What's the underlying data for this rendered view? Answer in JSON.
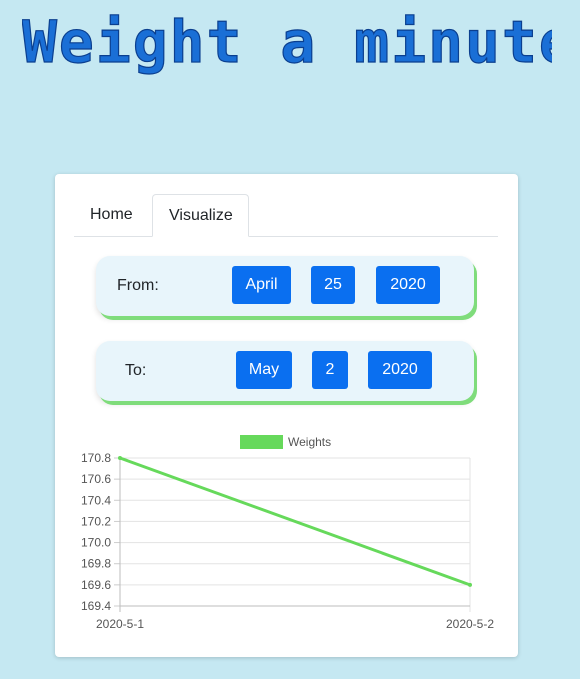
{
  "app": {
    "logo_text": "Weight a minute"
  },
  "tabs": [
    {
      "label": "Home",
      "active": false
    },
    {
      "label": "Visualize",
      "active": true
    }
  ],
  "range": {
    "from": {
      "label": "From:",
      "month": "April",
      "day": "25",
      "year": "2020"
    },
    "to": {
      "label": "To:",
      "month": "May",
      "day": "2",
      "year": "2020"
    }
  },
  "colors": {
    "background": "#c5e8f2",
    "logo": "#1a6fd6",
    "button": "#0a6ff0",
    "series": "#66d95b",
    "pill_shadow": "#7fdc7b"
  },
  "chart_data": {
    "type": "line",
    "x": [
      "2020-5-1",
      "2020-5-2"
    ],
    "series": [
      {
        "name": "Weights",
        "values": [
          170.8,
          169.6
        ]
      }
    ],
    "ylim": [
      169.4,
      170.8
    ],
    "yticks": [
      "170.8",
      "170.6",
      "170.4",
      "170.2",
      "170.0",
      "169.8",
      "169.6",
      "169.4"
    ],
    "legend": "top-center",
    "grid": true
  }
}
